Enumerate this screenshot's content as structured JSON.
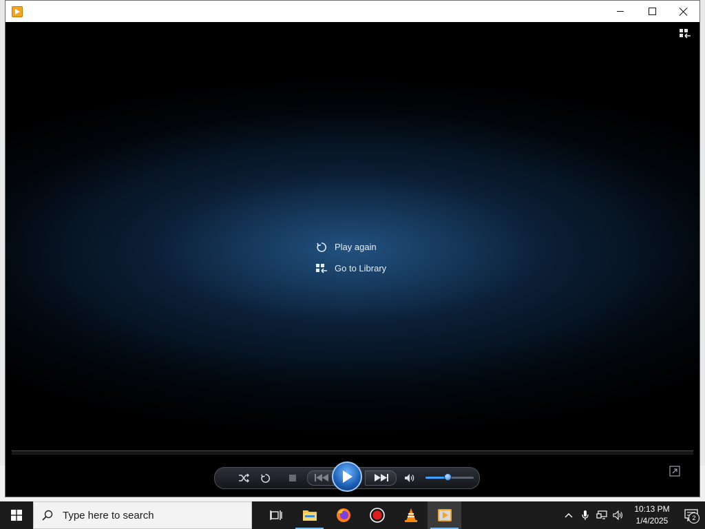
{
  "window": {
    "title": "",
    "buttons": {
      "minimize_icon": "minimize-icon",
      "maximize_icon": "maximize-icon",
      "close_icon": "close-icon"
    }
  },
  "player": {
    "menu": {
      "play_again": "Play again",
      "go_to_library": "Go to Library"
    },
    "volume_level": 0.45,
    "colors": {
      "accent": "#3fa1ff",
      "background": "#000000",
      "video_glow": "#265a8c"
    }
  },
  "taskbar": {
    "search_placeholder": "Type here to search",
    "apps": [
      "task-view",
      "file-explorer",
      "firefox",
      "recorder",
      "vlc",
      "media-player"
    ],
    "clock": {
      "time": "10:13 PM",
      "date": "1/4/2025"
    },
    "notification_count": "2",
    "colors": {
      "taskbar": "#1c1c1c",
      "running_indicator": "#76b9ed"
    }
  }
}
